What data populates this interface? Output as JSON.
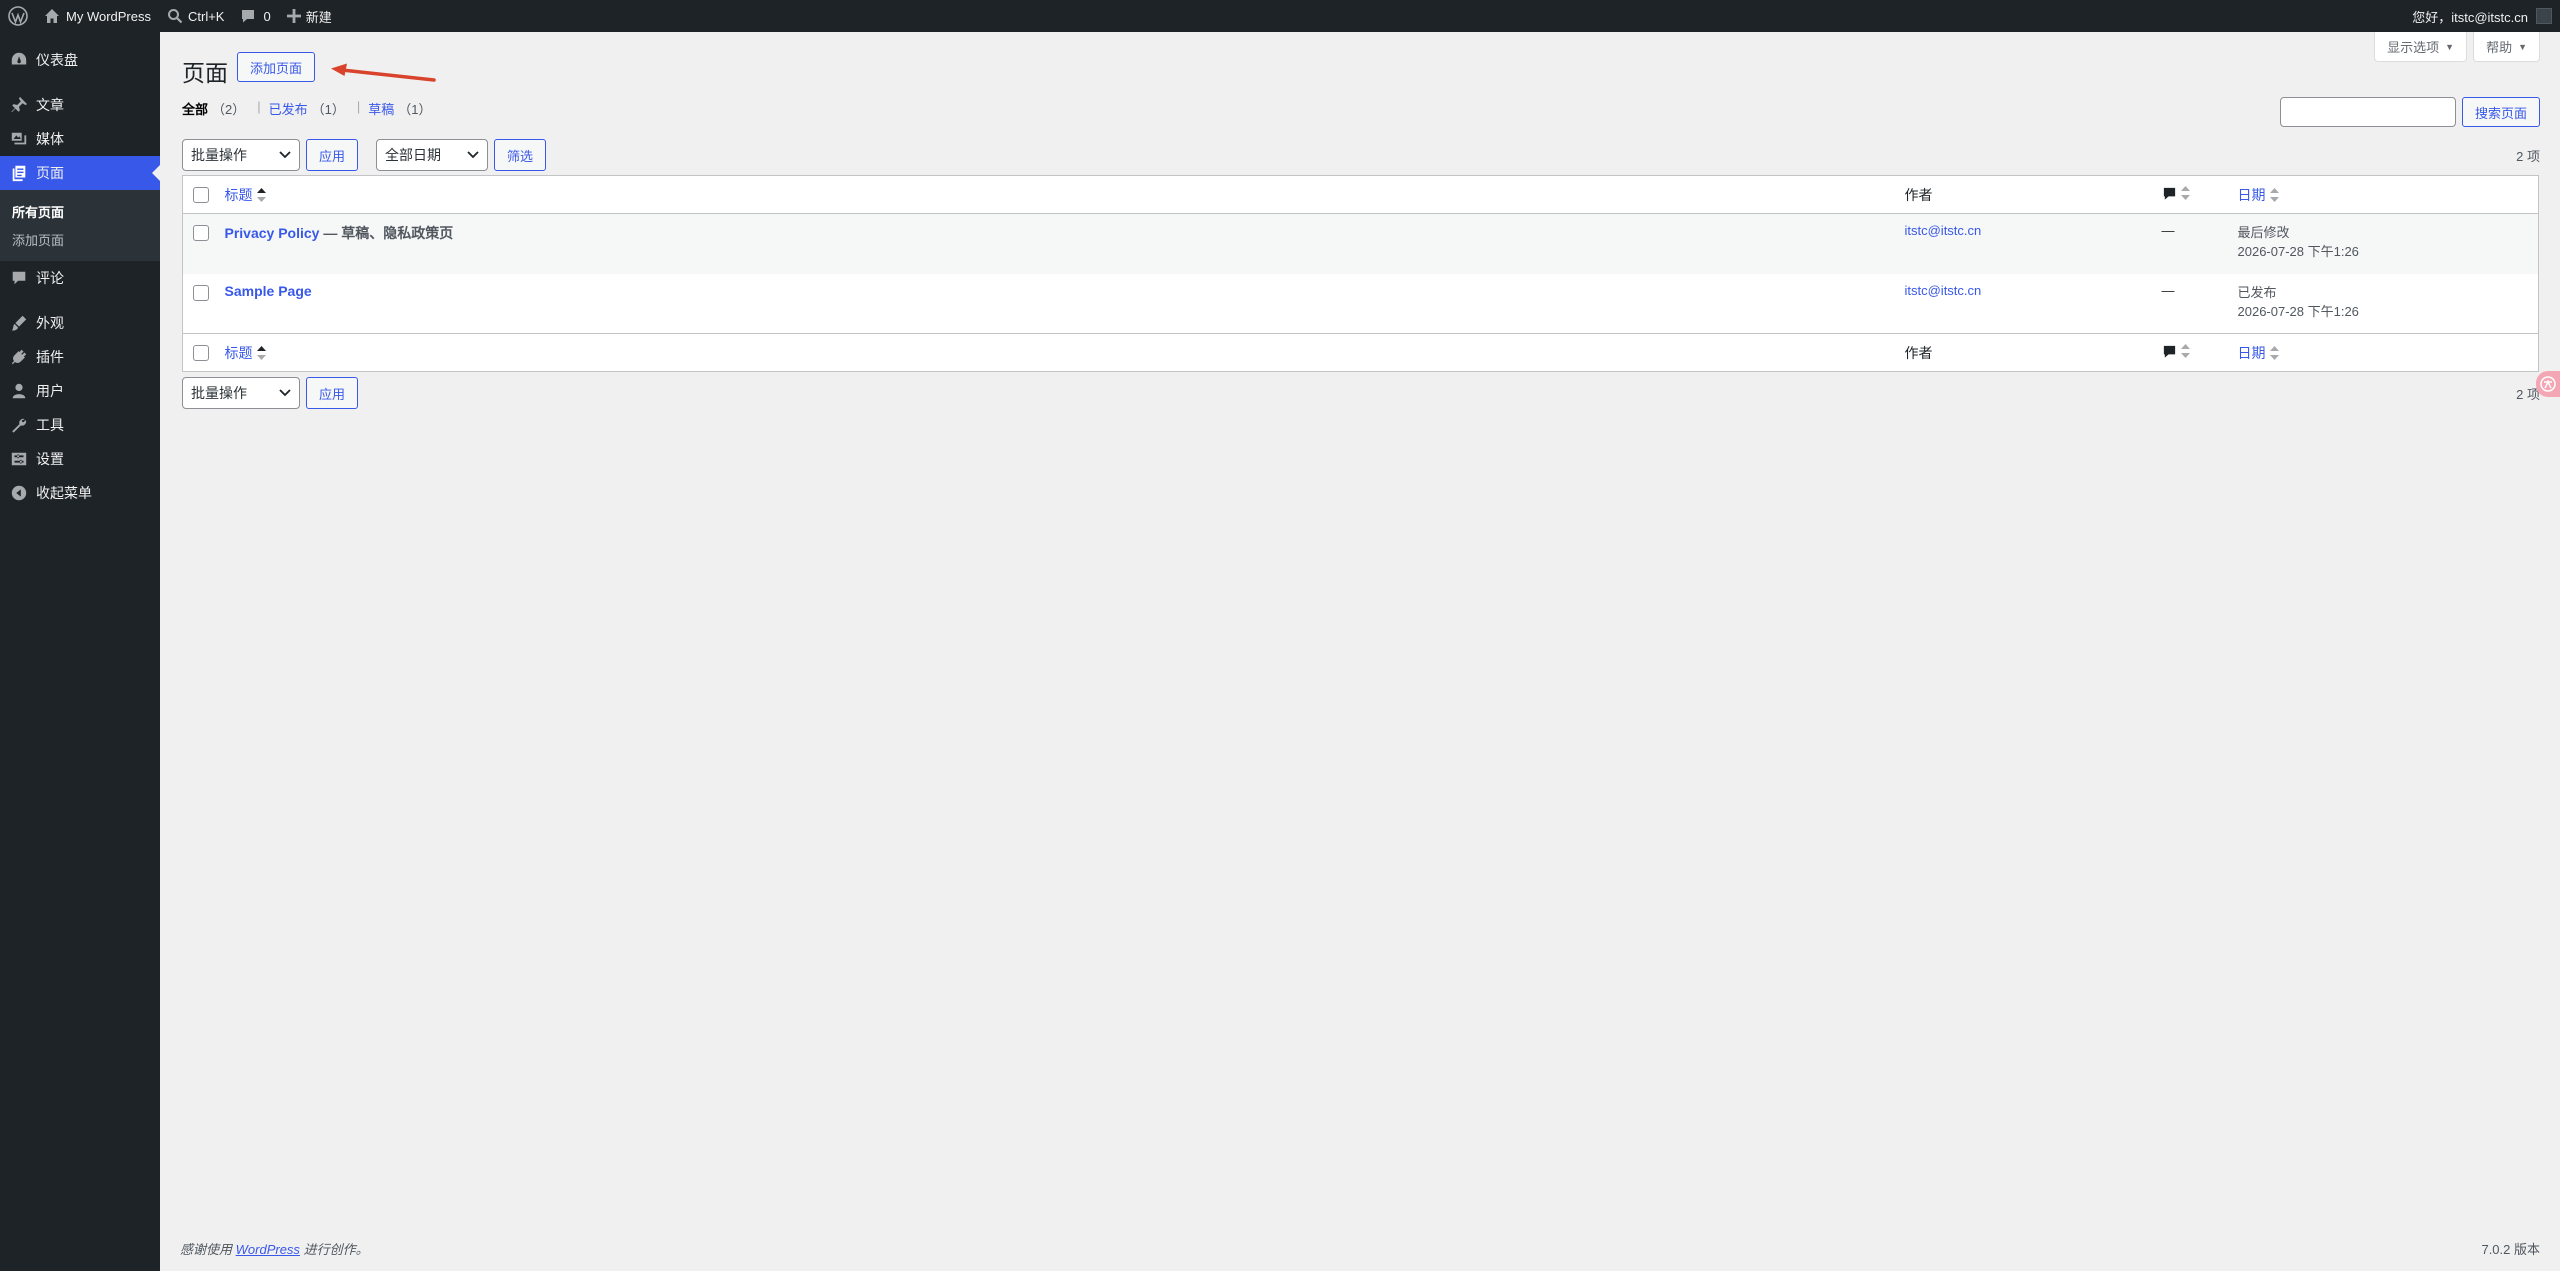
{
  "adminbar": {
    "site_name": "My WordPress",
    "search_shortcut": "Ctrl+K",
    "comments_count": "0",
    "new_label": "新建",
    "greeting": "您好，itstc@itstc.cn"
  },
  "sidebar": {
    "items": [
      {
        "label": "仪表盘",
        "icon": "dashboard-icon"
      },
      {
        "label": "文章",
        "icon": "pin-icon"
      },
      {
        "label": "媒体",
        "icon": "media-icon"
      },
      {
        "label": "页面",
        "icon": "pages-icon"
      },
      {
        "label": "评论",
        "icon": "comment-icon"
      },
      {
        "label": "外观",
        "icon": "appearance-icon"
      },
      {
        "label": "插件",
        "icon": "plugin-icon"
      },
      {
        "label": "用户",
        "icon": "user-icon"
      },
      {
        "label": "工具",
        "icon": "wrench-icon"
      },
      {
        "label": "设置",
        "icon": "settings-icon"
      },
      {
        "label": "收起菜单",
        "icon": "collapse-icon"
      }
    ],
    "submenu": [
      "所有页面",
      "添加页面"
    ]
  },
  "screen_meta": {
    "screen_options": "显示选项",
    "help": "帮助"
  },
  "page": {
    "title": "页面",
    "add_new": "添加页面"
  },
  "filters": {
    "all_label": "全部",
    "all_count": "（2）",
    "published_label": "已发布",
    "published_count": "（1）",
    "draft_label": "草稿",
    "draft_count": "（1）",
    "separator": "|"
  },
  "search": {
    "button": "搜索页面",
    "value": ""
  },
  "tablenav": {
    "bulk_actions": "批量操作",
    "apply": "应用",
    "all_dates": "全部日期",
    "filter": "筛选",
    "items_count": "2 项"
  },
  "table": {
    "columns": {
      "title": "标题",
      "author": "作者",
      "date": "日期"
    },
    "rows": [
      {
        "title": "Privacy Policy",
        "state": " — 草稿、隐私政策页",
        "author": "itstc@itstc.cn",
        "comments": "—",
        "date_status": "最后修改",
        "date": "2026-07-28 下午1:26"
      },
      {
        "title": "Sample Page",
        "state": "",
        "author": "itstc@itstc.cn",
        "comments": "—",
        "date_status": "已发布",
        "date": "2026-07-28 下午1:26"
      }
    ]
  },
  "footer": {
    "thanks_prefix": "感谢使用",
    "wordpress": "WordPress",
    "thanks_suffix": "进行创作。",
    "version": "7.0.2 版本"
  },
  "colors": {
    "admin_bar": "#1d2327",
    "accent": "#3858e9",
    "annotation_arrow": "#d9432b"
  }
}
